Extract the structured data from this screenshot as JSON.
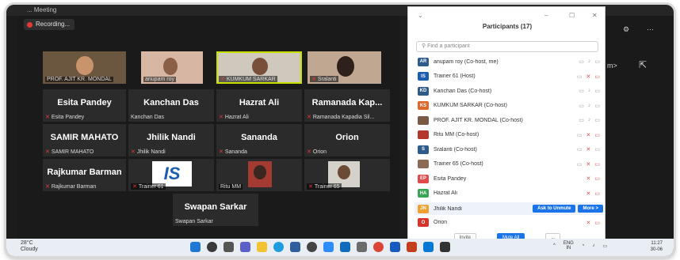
{
  "window": {
    "title": "... Meeting",
    "recording_label": "Recording..."
  },
  "tiles": [
    {
      "id": "t1",
      "name": "",
      "label": "PROF. AJIT KR. MONDAL",
      "type": "video"
    },
    {
      "id": "t2",
      "name": "",
      "label": "anupam roy",
      "type": "video"
    },
    {
      "id": "t3",
      "name": "",
      "label": "KUMKUM SARKAR",
      "type": "video"
    },
    {
      "id": "t4",
      "name": "",
      "label": "Sralanti",
      "type": "video"
    },
    {
      "id": "t5",
      "name": "Esita Pandey",
      "label": "Esita Pandey",
      "type": "name"
    },
    {
      "id": "t6",
      "name": "Kanchan Das",
      "label": "Kanchan Das",
      "type": "name"
    },
    {
      "id": "t7",
      "name": "Hazrat Ali",
      "label": "Hazrat Ali",
      "type": "name"
    },
    {
      "id": "t8",
      "name": "Ramanada Kap...",
      "label": "Ramanada Kapadia Sil...",
      "type": "name"
    },
    {
      "id": "t9",
      "name": "SAMIR MAHATO",
      "label": "SAMIR MAHATO",
      "type": "name"
    },
    {
      "id": "t10",
      "name": "Jhilik Nandi",
      "label": "Jhilik Nandi",
      "type": "name"
    },
    {
      "id": "t11",
      "name": "Sananda",
      "label": "Sananda",
      "type": "name"
    },
    {
      "id": "t12",
      "name": "Orion",
      "label": "Orion",
      "type": "name"
    },
    {
      "id": "t13",
      "name": "Rajkumar Barman",
      "label": "Rajkumar Barman",
      "type": "name"
    },
    {
      "id": "t14",
      "name": "",
      "label": "Trainer 61",
      "type": "video"
    },
    {
      "id": "t15",
      "name": "",
      "label": "Ritu MM",
      "type": "video"
    },
    {
      "id": "t16",
      "name": "",
      "label": "Trainer 65",
      "type": "video"
    },
    {
      "id": "t17",
      "name": "Swapan Sarkar",
      "label": "Swapan Sarkar",
      "type": "name"
    }
  ],
  "participants_panel": {
    "title": "Participants (17)",
    "search_placeholder": "Find a participant",
    "rows": [
      {
        "initials": "AR",
        "name": "anupam roy (Co-host, me)",
        "color": "#2d5b8c"
      },
      {
        "initials": "IS",
        "name": "Trainer 61 (Host)",
        "color": "#1a5cb0"
      },
      {
        "initials": "KD",
        "name": "Kanchan Das (Co-host)",
        "color": "#2d5b8c"
      },
      {
        "initials": "KS",
        "name": "KUMKUM SARKAR (Co-host)",
        "color": "#e0662a"
      },
      {
        "initials": "",
        "name": "PROF. AJIT KR. MONDAL (Co-host)",
        "color": "#7a5a46"
      },
      {
        "initials": "",
        "name": "Ritu MM (Co-host)",
        "color": "#b5362d"
      },
      {
        "initials": "S",
        "name": "Sralanti (Co-host)",
        "color": "#2d5b8c"
      },
      {
        "initials": "",
        "name": "Trainer 65 (Co-host)",
        "color": "#8b6b55"
      },
      {
        "initials": "EP",
        "name": "Esita Pandey",
        "color": "#e04a4a"
      },
      {
        "initials": "HA",
        "name": "Hazrat Ali",
        "color": "#3aa655"
      },
      {
        "initials": "JN",
        "name": "Jhilik Nandi",
        "color": "#f0a030"
      },
      {
        "initials": "O",
        "name": "Orion",
        "color": "#d9342b"
      }
    ],
    "ask_unmute_label": "Ask to Unmute",
    "more_label": "More >",
    "invite_label": "Invite",
    "mute_all_label": "Mute All",
    "more_footer_label": "..."
  },
  "right_controls": {
    "view_label": "m>"
  },
  "taskbar": {
    "temp": "28°C",
    "weather": "Cloudy",
    "lang_top": "ENG",
    "lang_bottom": "IN",
    "time": "11:27",
    "date": "30-06"
  }
}
